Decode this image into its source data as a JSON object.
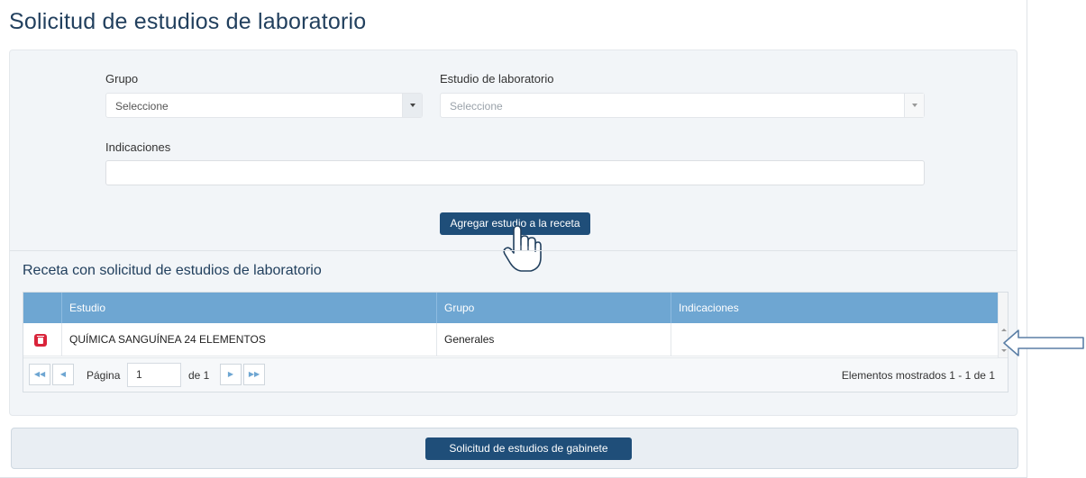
{
  "page": {
    "title": "Solicitud de estudios de laboratorio"
  },
  "form": {
    "grupo_label": "Grupo",
    "grupo_placeholder": "Seleccione",
    "estudio_label": "Estudio de laboratorio",
    "estudio_placeholder": "Seleccione",
    "indicaciones_label": "Indicaciones",
    "indicaciones_value": "",
    "add_button": "Agregar estudio a la receta"
  },
  "receta": {
    "title": "Receta con solicitud de estudios de laboratorio",
    "columns": [
      "Estudio",
      "Grupo",
      "Indicaciones"
    ],
    "rows": [
      {
        "estudio": "QUÍMICA SANGUÍNEA 24 ELEMENTOS",
        "grupo": "Generales",
        "indicaciones": ""
      }
    ],
    "pager": {
      "page_label": "Página",
      "page_value": "1",
      "of_label": "de 1",
      "info": "Elementos mostrados 1 - 1 de 1"
    }
  },
  "footer": {
    "gabinete_button": "Solicitud de estudios de gabinete"
  },
  "icons": {
    "delete": "trash-icon",
    "cursor": "hand-pointer-icon",
    "annotation": "arrow-left-icon"
  },
  "colors": {
    "primary_button": "#1f4e79",
    "grid_header": "#6ea6d2",
    "delete": "#d9243a",
    "title": "#22405e"
  }
}
